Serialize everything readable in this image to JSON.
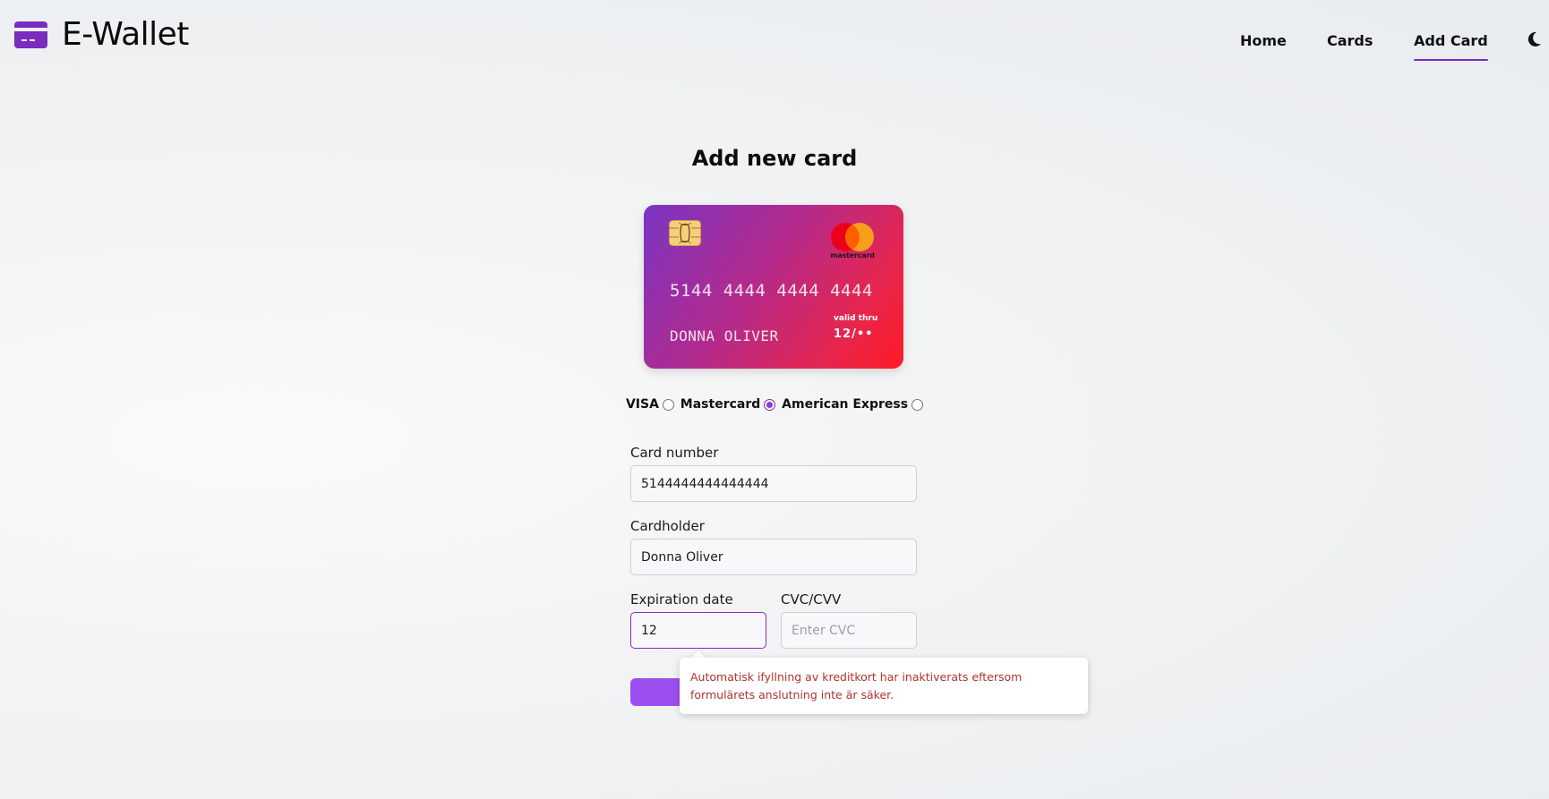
{
  "app": {
    "title": "E-Wallet",
    "accent_color": "#7b2bbd"
  },
  "nav": {
    "items": [
      {
        "label": "Home",
        "active": false
      },
      {
        "label": "Cards",
        "active": false
      },
      {
        "label": "Add Card",
        "active": true
      }
    ],
    "theme_toggle_icon": "moon-icon"
  },
  "main": {
    "title": "Add new card",
    "card_preview": {
      "number": "5144 4444 4444 4444",
      "holder": "DONNA OLIVER",
      "valid_label": "valid thru",
      "valid_value": "12/••",
      "brand": "mastercard",
      "brand_text": "mastercard"
    },
    "card_types": [
      {
        "label": "VISA",
        "checked": false
      },
      {
        "label": "Mastercard",
        "checked": true
      },
      {
        "label": "American Express",
        "checked": false
      }
    ],
    "fields": {
      "card_number": {
        "label": "Card number",
        "value": "5144444444444444"
      },
      "cardholder": {
        "label": "Cardholder",
        "value": "Donna Oliver"
      },
      "expiration": {
        "label": "Expiration date",
        "value": "12"
      },
      "cvc": {
        "label": "CVC/CVV",
        "value": "",
        "placeholder": "Enter CVC"
      }
    },
    "submit_label": ""
  },
  "tooltip": {
    "text": "Automatisk ifyllning av kreditkort har inaktiverats eftersom formulärets anslutning inte är säker."
  }
}
